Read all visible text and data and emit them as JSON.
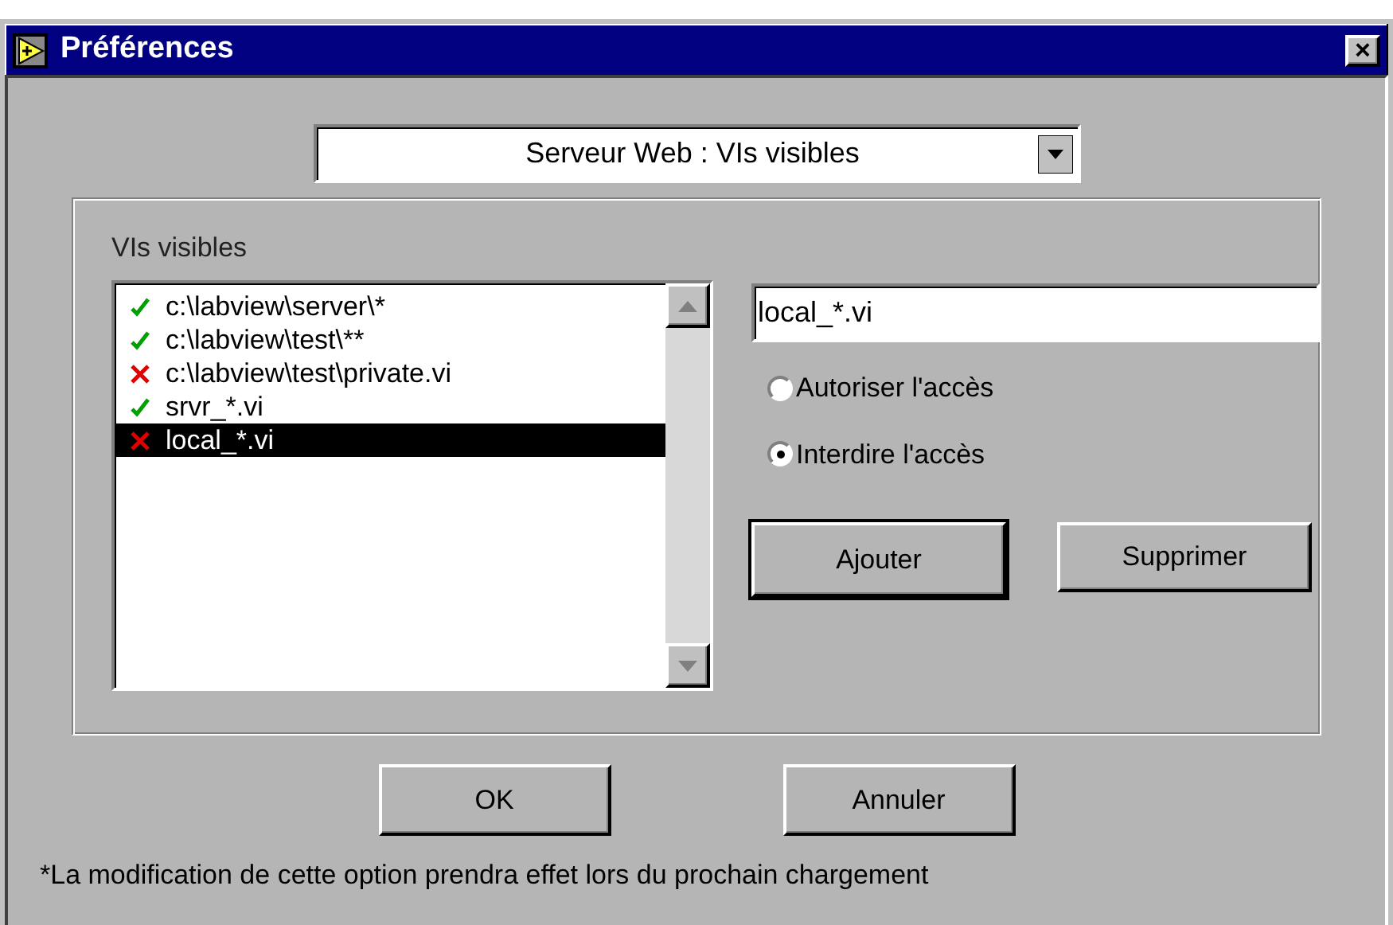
{
  "window": {
    "title": "Préférences",
    "close": "×"
  },
  "category": {
    "value": "Serveur Web : VIs visibles"
  },
  "list": {
    "label": "VIs visibles",
    "items": [
      {
        "text": "c:\\labview\\server\\*",
        "kind": "allow",
        "selected": false
      },
      {
        "text": "c:\\labview\\test\\**",
        "kind": "allow",
        "selected": false
      },
      {
        "text": "c:\\labview\\test\\private.vi",
        "kind": "deny",
        "selected": false
      },
      {
        "text": "srvr_*.vi",
        "kind": "allow",
        "selected": false
      },
      {
        "text": "local_*.vi",
        "kind": "deny",
        "selected": true
      }
    ]
  },
  "pattern": {
    "value": "local_*.vi"
  },
  "access": [
    {
      "label": "Autoriser l'accès",
      "selected": false
    },
    {
      "label": "Interdire l'accès",
      "selected": true
    }
  ],
  "edit_buttons": [
    {
      "label": "Ajouter",
      "default": true
    },
    {
      "label": "Supprimer",
      "default": false
    }
  ],
  "buttons": [
    {
      "label": "OK"
    },
    {
      "label": "Annuler"
    }
  ],
  "footnote": "*La modification de cette option prendra effet lors du prochain chargement"
}
